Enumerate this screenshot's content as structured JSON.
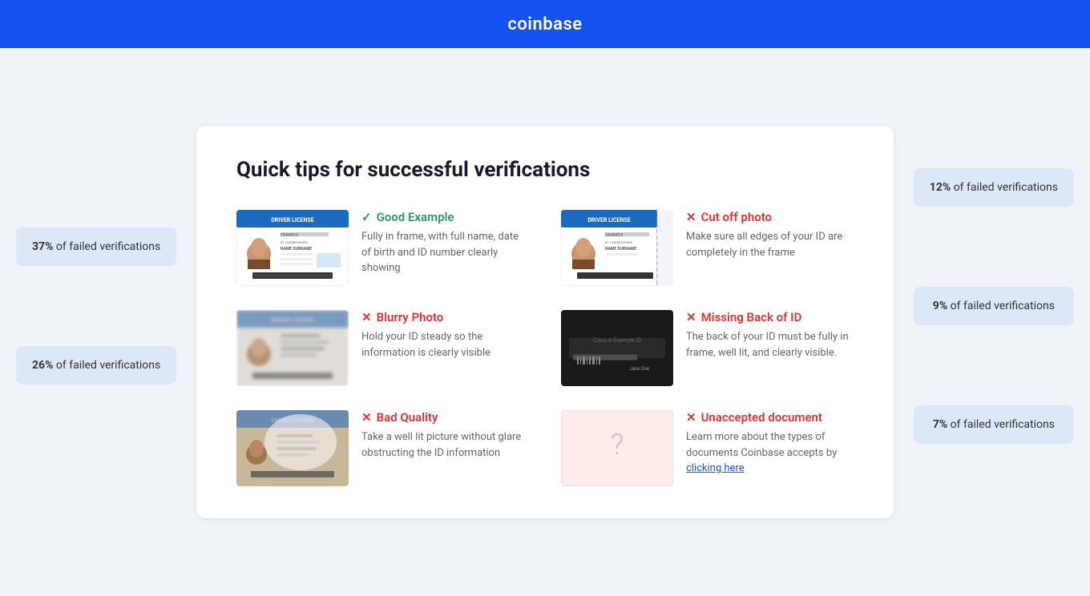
{
  "header": {
    "logo": "coinbase"
  },
  "side_badges": {
    "left": [
      {
        "percent": "37%",
        "label": "of failed verifications"
      },
      {
        "percent": "26%",
        "label": "of failed verifications"
      }
    ],
    "right": [
      {
        "percent": "12%",
        "label": "of failed verifications"
      },
      {
        "percent": "9%",
        "label": "of failed verifications"
      },
      {
        "percent": "7%",
        "label": "of failed verifications"
      }
    ]
  },
  "card": {
    "title": "Quick tips for successful verifications",
    "tips": [
      {
        "id": "good-example",
        "type": "good",
        "icon": "check",
        "label": "Good Example",
        "description": "Fully in frame, with full name, date of birth and ID number clearly showing"
      },
      {
        "id": "cut-off-photo",
        "type": "bad",
        "icon": "x",
        "label": "Cut off photo",
        "description": "Make sure all edges of your ID are completely in the frame"
      },
      {
        "id": "blurry-photo",
        "type": "bad",
        "icon": "x",
        "label": "Blurry Photo",
        "description": "Hold your ID steady so the information is clearly visible"
      },
      {
        "id": "missing-back",
        "type": "bad",
        "icon": "x",
        "label": "Missing Back of ID",
        "description": "The back of your ID must be fully in frame, well lit, and clearly visible."
      },
      {
        "id": "bad-quality",
        "type": "bad",
        "icon": "x",
        "label": "Bad Quality",
        "description": "Take a well lit picture without glare obstructing the ID information"
      },
      {
        "id": "unaccepted-document",
        "type": "bad",
        "icon": "x",
        "label": "Unaccepted document",
        "description": "Learn more about the types of documents Coinbase accepts by ",
        "link": "clicking here"
      }
    ]
  }
}
